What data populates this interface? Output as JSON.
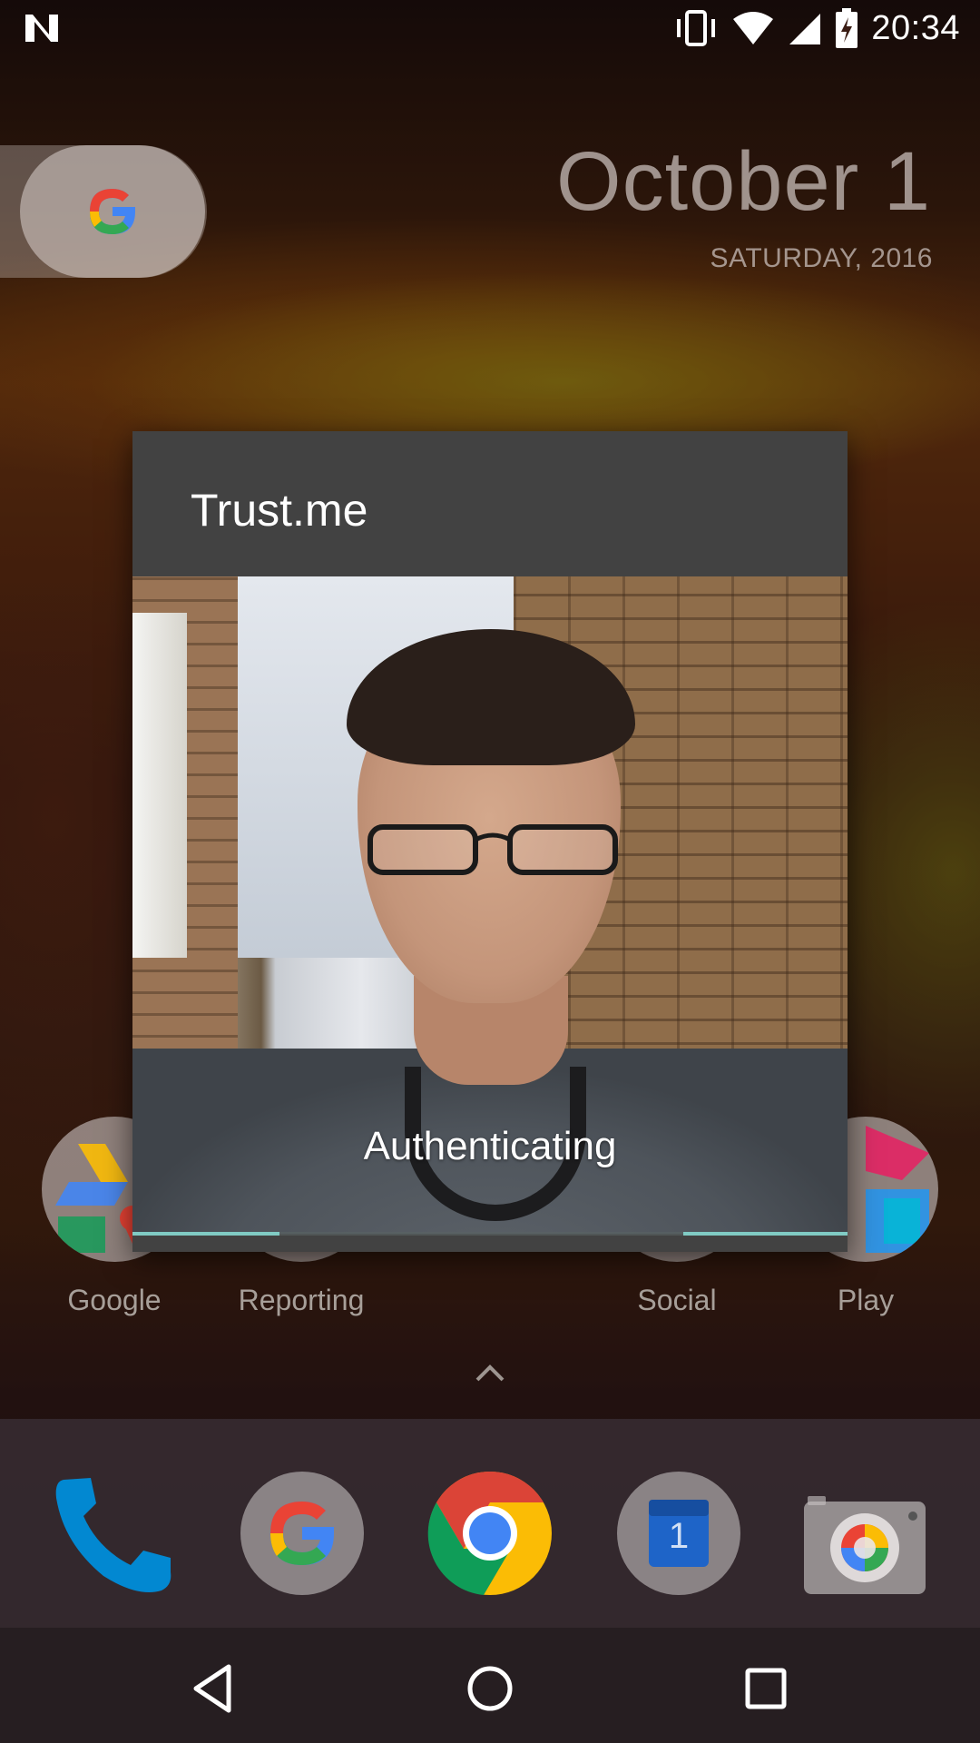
{
  "status_bar": {
    "time": "20:34",
    "icons": [
      "n-logo-icon",
      "vibrate-icon",
      "wifi-icon",
      "cell-signal-icon",
      "battery-charging-icon"
    ]
  },
  "home": {
    "date": "October 1",
    "date_sub": "SATURDAY, 2016",
    "apps": [
      {
        "label": "Google",
        "icon": "google-folder-icon"
      },
      {
        "label": "Reporting",
        "icon": "reporting-folder-icon"
      },
      {
        "label": "Social",
        "icon": "social-folder-icon"
      },
      {
        "label": "Play",
        "icon": "play-folder-icon"
      }
    ],
    "dock": [
      "phone-icon",
      "google-icon",
      "chrome-icon",
      "calendar-icon",
      "camera-icon"
    ],
    "calendar_day": "1"
  },
  "dialog": {
    "title": "Trust.me",
    "status": "Authenticating",
    "progress_segments": [
      [
        0,
        0.205
      ],
      [
        0.77,
        1.0
      ]
    ]
  },
  "colors": {
    "dialog_bg": "#424242",
    "progress": "#80cbc4"
  }
}
